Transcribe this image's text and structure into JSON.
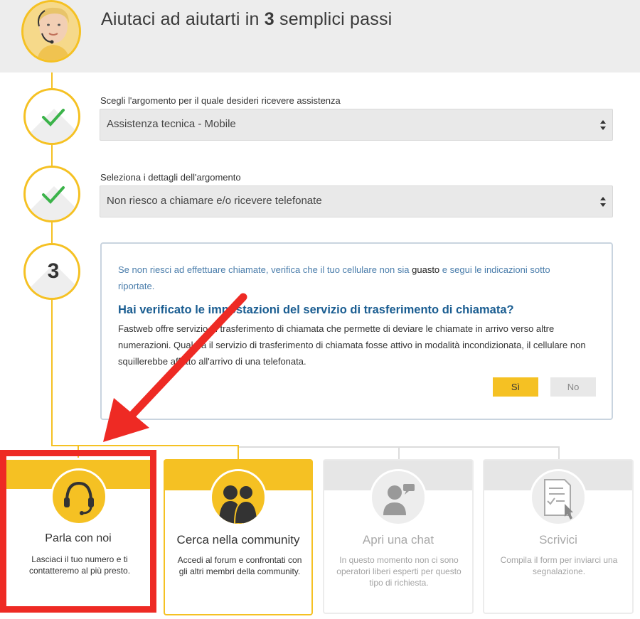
{
  "header": {
    "title_prefix": "Aiutaci ad aiutarti in",
    "title_number": "3",
    "title_suffix": "semplici passi"
  },
  "steps": [
    {
      "state": "done",
      "icon": "check-icon"
    },
    {
      "state": "done",
      "icon": "check-icon"
    },
    {
      "state": "current",
      "number": "3"
    }
  ],
  "topic": {
    "label": "Scegli l'argomento per il quale desideri ricevere assistenza",
    "value": "Assistenza tecnica - Mobile"
  },
  "detail": {
    "label": "Seleziona i dettagli dell'argomento",
    "value": "Non riesco a chiamare e/o ricevere telefonate"
  },
  "info": {
    "intro_a": "Se non riesci ad effettuare chiamate, verifica che il tuo cellulare non sia",
    "intro_dark": "guasto",
    "intro_b": "e segui le indicazioni sotto riportate.",
    "heading": "Hai verificato le impostazioni del servizio di trasferimento di chiamata?",
    "body": "Fastweb offre servizio di trasferimento di chiamata che permette di deviare le chiamate in arrivo verso altre numerazioni. Qualora il servizio di trasferimento di chiamata fosse attivo in modalità incondizionata, il cellulare non squillerebbe affatto all'arrivo di una telefonata.",
    "yes_label": "Sì",
    "no_label": "No"
  },
  "cards": [
    {
      "title": "Parla con noi",
      "desc": "Lasciaci il tuo numero e ti contatteremo al più presto.",
      "icon": "headset-icon",
      "state": "active"
    },
    {
      "title": "Cerca nella community",
      "desc": "Accedi al forum e confrontati con gli altri membri della community.",
      "icon": "community-icon",
      "state": "active"
    },
    {
      "title": "Apri una chat",
      "desc": "In questo momento non ci sono operatori liberi esperti per questo tipo di richiesta.",
      "icon": "chat-icon",
      "state": "disabled"
    },
    {
      "title": "Scrivici",
      "desc": "Compila il form per inviarci una segnalazione.",
      "icon": "form-icon",
      "state": "disabled"
    }
  ],
  "colors": {
    "accent": "#f5c123",
    "link_blue": "#4a7dab",
    "heading_blue": "#1a5d91",
    "check_green": "#3bb34a",
    "annotation_red": "#ee2a24"
  }
}
